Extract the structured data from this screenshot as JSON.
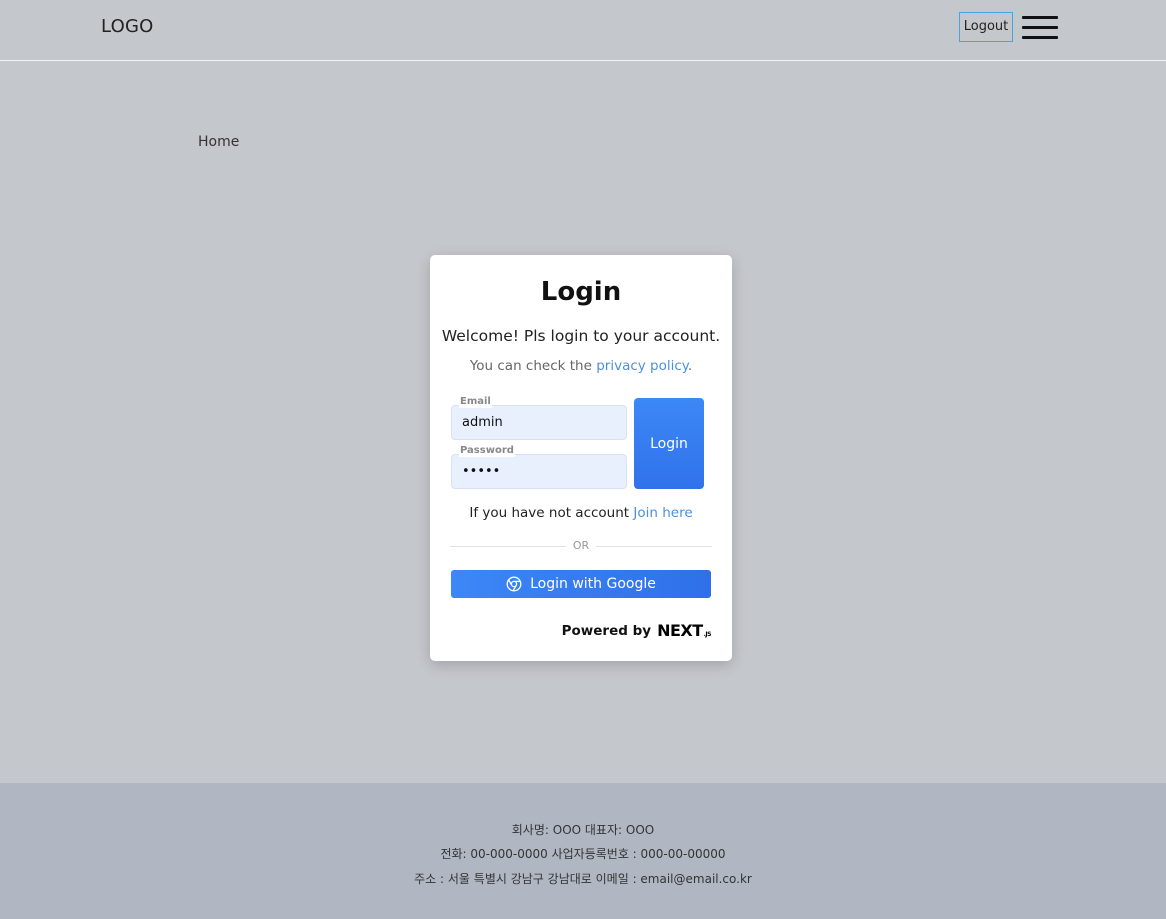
{
  "header": {
    "logo": "LOGO",
    "logout_label": "Logout"
  },
  "breadcrumb": {
    "home": "Home"
  },
  "login_card": {
    "title": "Login",
    "welcome": "Welcome! Pls login to your account.",
    "policy_prefix": "You can check the ",
    "policy_link": "privacy policy",
    "policy_suffix": ".",
    "email_label": "Email",
    "email_value": "admin",
    "password_label": "Password",
    "password_value": "admin",
    "login_button": "Login",
    "join_prefix": "If you have not account ",
    "join_link": "Join here",
    "or_text": "OR",
    "google_button": "Login with Google",
    "powered_by": "Powered by",
    "next_logo": "NEXT",
    "next_logo_suffix": ".JS"
  },
  "footer": {
    "line1": "회사명: OOO  대표자: OOO",
    "line2": "전화: 00-000-0000  사업자등록번호 : 000-00-00000",
    "line3": "주소 : 서울 특별시 강남구 강남대로  이메일 : email@email.co.kr"
  },
  "colors": {
    "page_bg": "#c4c7cc",
    "footer_bg": "#b1b7c2",
    "accent": "#3c88f7",
    "link": "#4a90e2",
    "input_bg": "#e8f0fd"
  },
  "icons": {
    "menu": "hamburger-icon",
    "google": "chrome-icon"
  }
}
